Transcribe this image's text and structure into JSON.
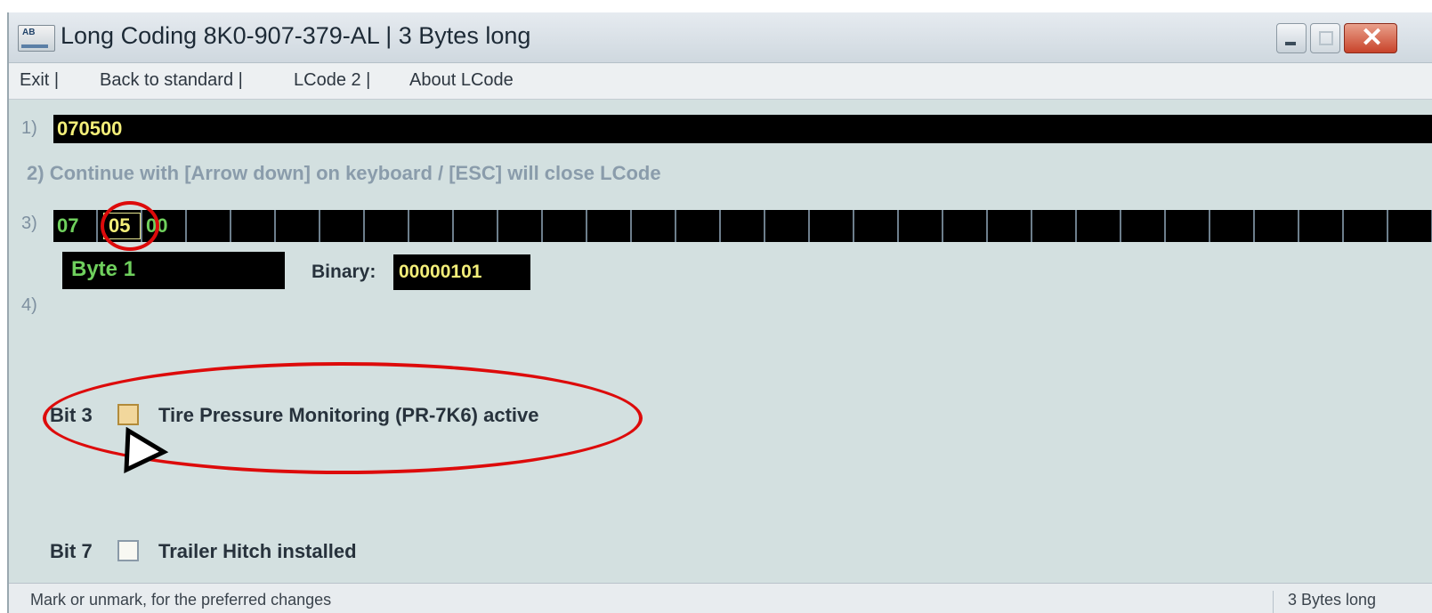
{
  "window": {
    "title": "Long Coding  8K0-907-379-AL  |  3 Bytes long",
    "close_glyph": "✕"
  },
  "menu": {
    "items": [
      "Exit |",
      "Back to standard |",
      "LCode 2 |",
      "About LCode"
    ]
  },
  "rows": {
    "row1_label": "1)",
    "coding_value": "070500",
    "row2_label": "2)",
    "hint": "Continue with [Arrow down] on keyboard / [ESC] will close LCode",
    "row3_label": "3)",
    "bytes": [
      "07",
      "05",
      "00"
    ],
    "row4_label": "4)"
  },
  "byte_info": {
    "byte_label": "Byte 1",
    "binary_label": "Binary:",
    "binary_value": "00000101"
  },
  "bits": [
    {
      "label": "Bit 3",
      "description": "Tire Pressure Monitoring (PR-7K6) active",
      "checked": false
    },
    {
      "label": "Bit 7",
      "description": "Trailer Hitch installed",
      "checked": false
    }
  ],
  "status": {
    "left": "Mark or unmark, for the preferred changes",
    "right": "3 Bytes long"
  },
  "colors": {
    "accent_yellow": "#f3ee79",
    "accent_green": "#6fd05d",
    "annotation_red": "#dd0b0b"
  }
}
